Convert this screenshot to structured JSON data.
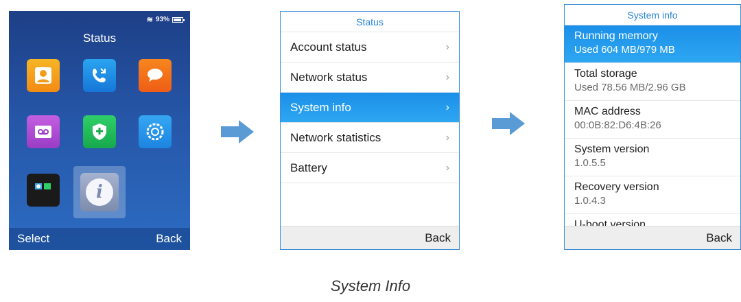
{
  "screen1": {
    "status_bar": {
      "battery_text": "93%",
      "icons": [
        "wifi-icon",
        "battery-icon"
      ]
    },
    "title": "Status",
    "apps": [
      "contacts-icon",
      "calls-icon",
      "messages-icon",
      "voicemail-icon",
      "security-icon",
      "settings-icon",
      "tools-icon",
      "info-icon"
    ],
    "softkeys": {
      "left": "Select",
      "right": "Back"
    }
  },
  "screen2": {
    "title": "Status",
    "items": [
      {
        "label": "Account status",
        "chevron": "›"
      },
      {
        "label": "Network status",
        "chevron": "›"
      },
      {
        "label": "System info",
        "chevron": "›",
        "selected": true
      },
      {
        "label": "Network statistics",
        "chevron": "›"
      },
      {
        "label": "Battery",
        "chevron": "›"
      }
    ],
    "softkey_right": "Back"
  },
  "screen3": {
    "title": "System info",
    "items": [
      {
        "label": "Running memory",
        "value": "Used 604 MB/979 MB",
        "selected": true
      },
      {
        "label": "Total storage",
        "value": "Used 78.56 MB/2.96 GB"
      },
      {
        "label": "MAC address",
        "value": "00:0B:82:D6:4B:26"
      },
      {
        "label": "System version",
        "value": "1.0.5.5"
      },
      {
        "label": "Recovery version",
        "value": "1.0.4.3"
      },
      {
        "label": "U-boot version",
        "value": ""
      }
    ],
    "softkey_right": "Back"
  },
  "caption": "System Info",
  "colors": {
    "accent": "#2a86d6",
    "selected_bg": "#1b8fe8",
    "arrow": "#5b9bd5"
  }
}
